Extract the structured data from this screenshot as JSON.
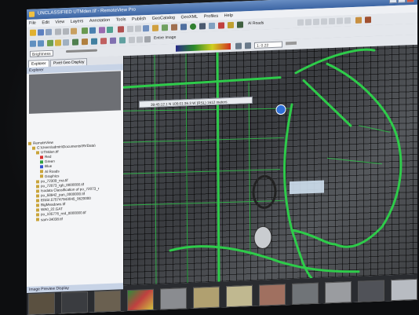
{
  "window": {
    "title": "UNCLASSIFIED UTMden.tif - RemoteView Pro"
  },
  "menu": [
    "File",
    "Edit",
    "View",
    "Layers",
    "Annotation",
    "Tools",
    "Publish",
    "GeoCatalog",
    "GeoXML",
    "Profiles",
    "Help"
  ],
  "toolbar": {
    "roads_label": "Al Roads",
    "entire_image_label": "Entire Image",
    "zoom_value": "1: 0.22",
    "enhance_select": "Brightness"
  },
  "left_panel": {
    "tabs": [
      "Explorer",
      "Pixel Geo Display"
    ],
    "explorer_title": "Explorer",
    "tree": [
      {
        "label": "RemoteView",
        "indent": 0
      },
      {
        "label": "C:\\Users\\admin\\Documents\\RVData\\",
        "indent": 1
      },
      {
        "label": "UTMden.tif",
        "indent": 2
      },
      {
        "label": "Red",
        "indent": 3,
        "swatch": "#d93030"
      },
      {
        "label": "Green",
        "indent": 3,
        "swatch": "#30a040"
      },
      {
        "label": "Blue",
        "indent": 3,
        "swatch": "#3050d0"
      },
      {
        "label": "Al Roads",
        "indent": 3
      },
      {
        "label": "Graphics",
        "indent": 3
      },
      {
        "label": "po_72309_rna.tif",
        "indent": 2
      },
      {
        "label": "po_72073_rgb_0000000.tif",
        "indent": 2
      },
      {
        "label": "Isodata Classification of po_72073_r",
        "indent": 2
      },
      {
        "label": "po_58942_pan_0000000.tif",
        "indent": 2
      },
      {
        "label": "ElSSI.575747943045_0620000",
        "indent": 2
      },
      {
        "label": "BigMeadows.tif",
        "indent": 2
      },
      {
        "label": "WA0_22.GAT",
        "indent": 2
      },
      {
        "label": "po_105776_red_0000000.tif",
        "indent": 2
      },
      {
        "label": "sam-34038.tif",
        "indent": 2
      }
    ]
  },
  "map": {
    "tooltip": "39:45:12.1 N 105:01:36.3 W (RSL) 1612 meters"
  },
  "bottom_panel": {
    "title": "Image Preview Display"
  }
}
